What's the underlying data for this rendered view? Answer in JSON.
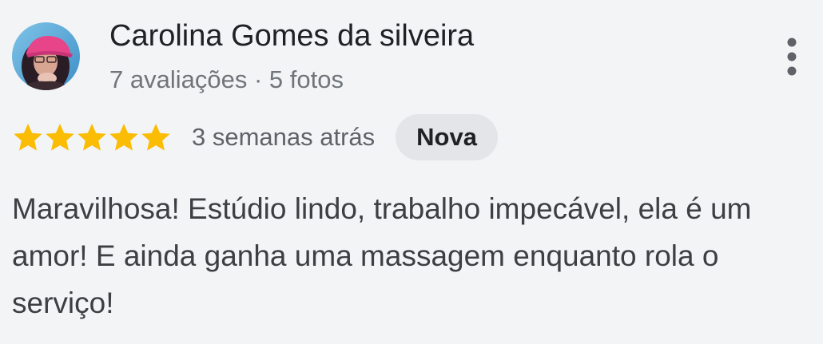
{
  "reviewer": {
    "name": "Carolina Gomes da silveira",
    "meta": "7 avaliações · 5 fotos",
    "avatar_icon": "profile-photo"
  },
  "rating": {
    "stars": 5,
    "max": 5,
    "star_color": "#fbbc04"
  },
  "review": {
    "time": "3 semanas atrás",
    "badge": "Nova",
    "text": "Maravilhosa! Estúdio lindo, trabalho impecável, ela é um amor! E ainda ganha uma massagem enquanto rola o serviço!"
  },
  "menu": {
    "icon": "more-vert-icon"
  },
  "colors": {
    "background": "#f3f4f6",
    "name": "#202124",
    "meta": "#70757a",
    "badge_bg": "#e3e5e8",
    "text": "#3c4043"
  }
}
